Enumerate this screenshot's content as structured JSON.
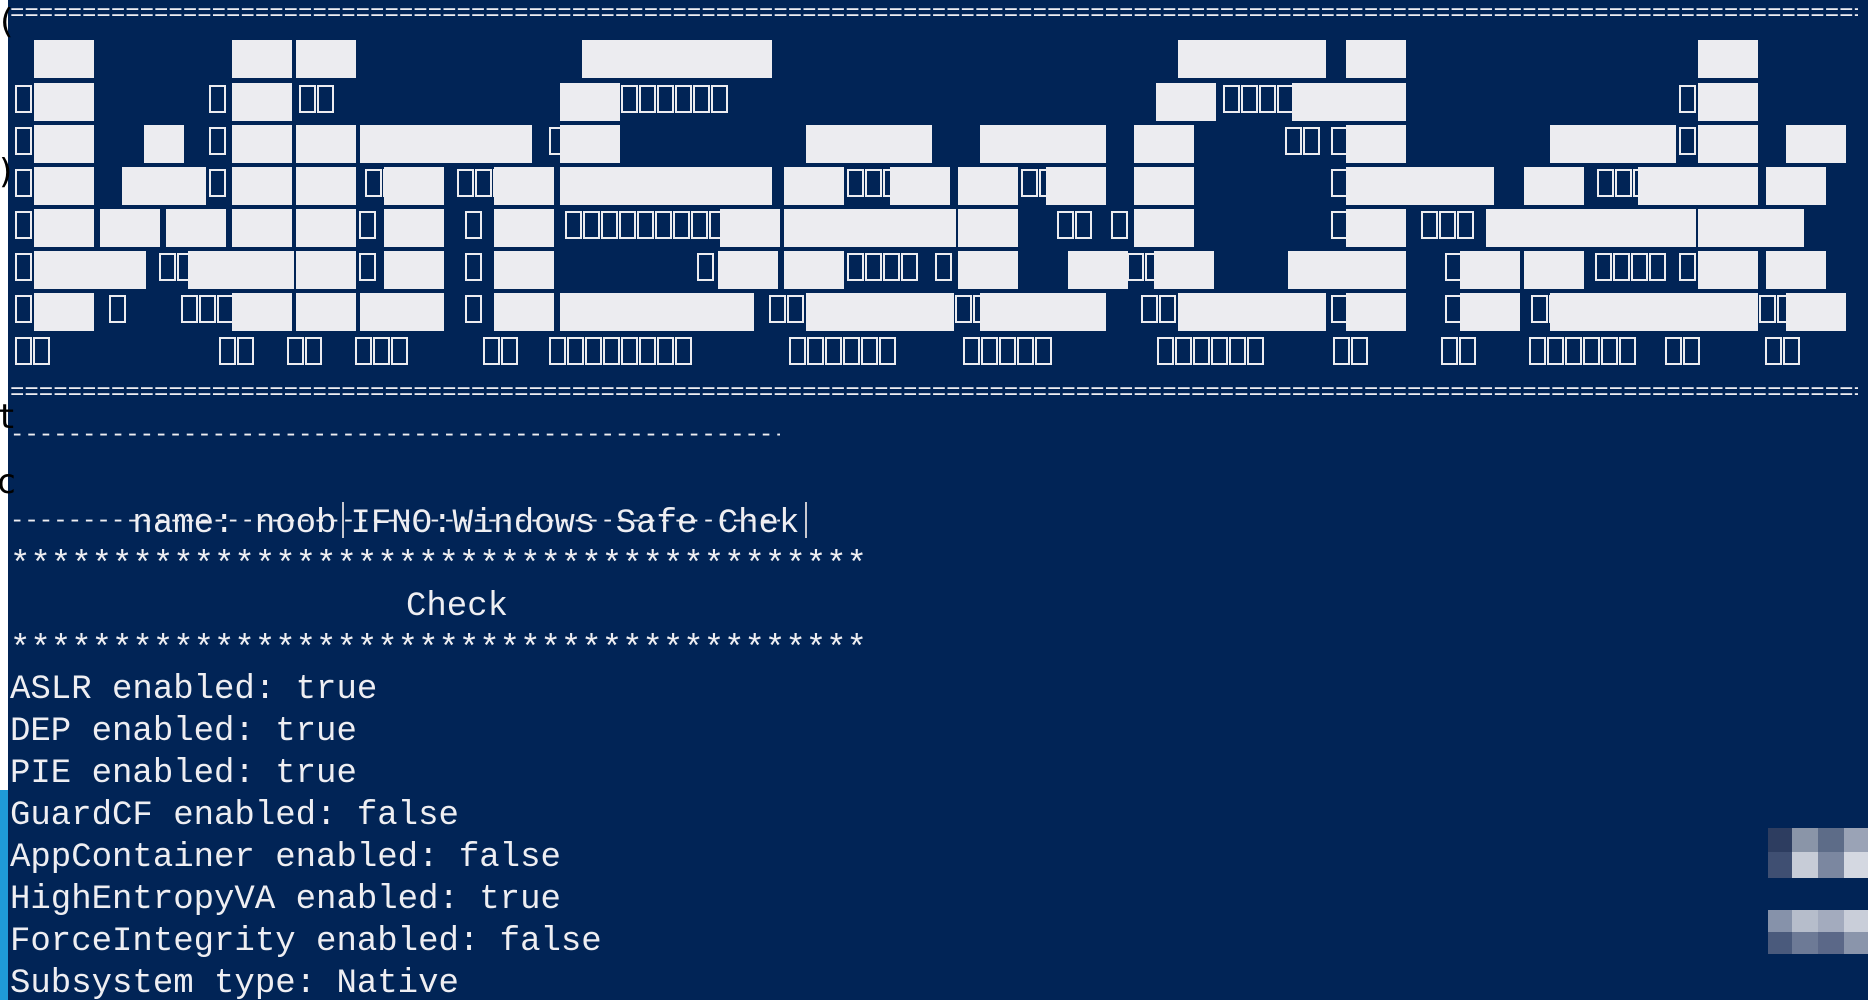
{
  "window": {
    "type": "console",
    "background_color": "#012456",
    "text_color": "#eeeef2"
  },
  "edge_chars": [
    "(",
    ")",
    "t",
    "c"
  ],
  "banner": {
    "top_rule": "==============================================================================================================================================",
    "bottom_rule": "=============================================================================================================================================="
  },
  "info": {
    "dash_top": "------------------------------------------------------------",
    "name_label": "name: noob",
    "info_text": "IFNO:Windows Safe Chek",
    "dash_bottom": "------------------------------------------------------------"
  },
  "check": {
    "star_top": "******************************************",
    "title": "Check",
    "star_bottom": "******************************************"
  },
  "results": [
    {
      "label": "ASLR enabled: true"
    },
    {
      "label": "DEP enabled: true"
    },
    {
      "label": "PIE enabled: true"
    },
    {
      "label": "GuardCF enabled: false"
    },
    {
      "label": "AppContainer enabled: false"
    },
    {
      "label": "HighEntropyVA enabled: true"
    },
    {
      "label": "ForceIntegrity enabled: false"
    },
    {
      "label": "Subsystem type: Native"
    }
  ]
}
